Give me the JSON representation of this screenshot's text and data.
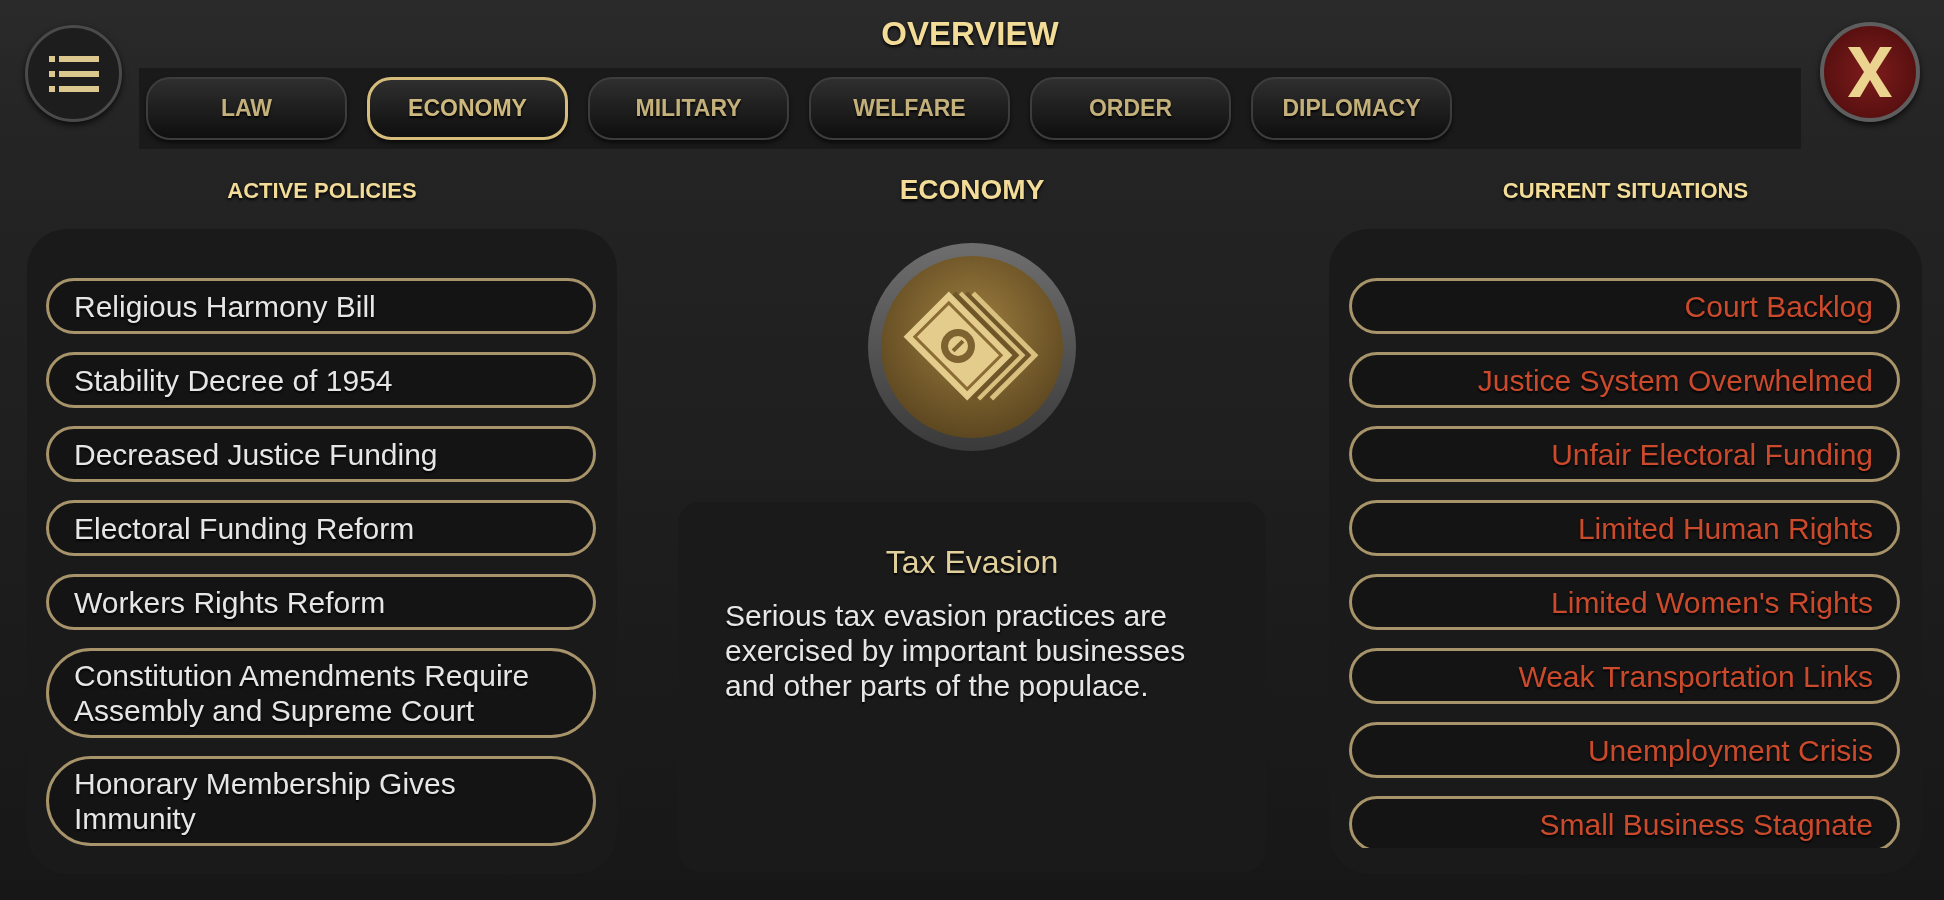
{
  "header": {
    "title": "OVERVIEW"
  },
  "tabs": [
    {
      "label": "LAW",
      "selected": false
    },
    {
      "label": "ECONOMY",
      "selected": true
    },
    {
      "label": "MILITARY",
      "selected": false
    },
    {
      "label": "WELFARE",
      "selected": false
    },
    {
      "label": "ORDER",
      "selected": false
    },
    {
      "label": "DIPLOMACY",
      "selected": false
    }
  ],
  "active_policies": {
    "title": "ACTIVE POLICIES",
    "items": [
      "Religious Harmony Bill",
      "Stability Decree of 1954",
      "Decreased Justice Funding",
      "Electoral Funding Reform",
      "Workers Rights Reform",
      "Constitution Amendments Require Assembly and Supreme Court",
      "Honorary Membership Gives Immunity"
    ]
  },
  "category": {
    "title": "ECONOMY"
  },
  "situation_detail": {
    "title": "Tax Evasion",
    "description": "Serious tax evasion practices are exercised by important businesses and other parts of the populace."
  },
  "current_situations": {
    "title": "CURRENT SITUATIONS",
    "items": [
      "Court Backlog",
      "Justice System Overwhelmed",
      "Unfair Electoral Funding",
      "Limited Human Rights",
      "Limited Women's Rights",
      "Weak Transportation Links",
      "Unemployment Crisis",
      "Small Business Stagnate"
    ]
  }
}
